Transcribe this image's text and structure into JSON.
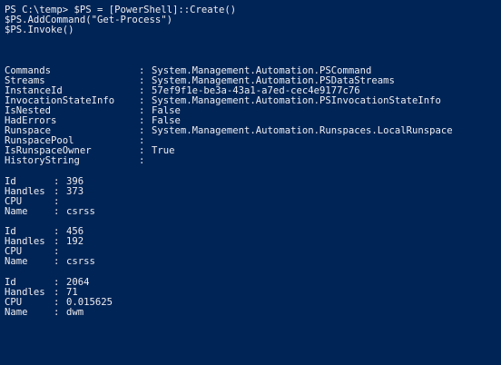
{
  "window": {
    "background": "#012456",
    "foreground": "#eeedf0"
  },
  "prompt_lines": [
    "PS C:\\temp> $PS = [PowerShell]::Create()",
    "$PS.AddCommand(\"Get-Process\")",
    "$PS.Invoke()"
  ],
  "properties": [
    {
      "key": "Commands",
      "value": "System.Management.Automation.PSCommand"
    },
    {
      "key": "Streams",
      "value": "System.Management.Automation.PSDataStreams"
    },
    {
      "key": "InstanceId",
      "value": "57ef9f1e-be3a-43a1-a7ed-cec4e9177c76"
    },
    {
      "key": "InvocationStateInfo",
      "value": "System.Management.Automation.PSInvocationStateInfo"
    },
    {
      "key": "IsNested",
      "value": "False"
    },
    {
      "key": "HadErrors",
      "value": "False"
    },
    {
      "key": "Runspace",
      "value": "System.Management.Automation.Runspaces.LocalRunspace"
    },
    {
      "key": "RunspacePool",
      "value": ""
    },
    {
      "key": "IsRunspaceOwner",
      "value": "True"
    },
    {
      "key": "HistoryString",
      "value": ""
    }
  ],
  "separator": ":",
  "processes": [
    {
      "fields": [
        {
          "key": "Id",
          "value": "396"
        },
        {
          "key": "Handles",
          "value": "373"
        },
        {
          "key": "CPU",
          "value": ""
        },
        {
          "key": "Name",
          "value": "csrss"
        }
      ]
    },
    {
      "fields": [
        {
          "key": "Id",
          "value": "456"
        },
        {
          "key": "Handles",
          "value": "192"
        },
        {
          "key": "CPU",
          "value": ""
        },
        {
          "key": "Name",
          "value": "csrss"
        }
      ]
    },
    {
      "fields": [
        {
          "key": "Id",
          "value": "2064"
        },
        {
          "key": "Handles",
          "value": "71"
        },
        {
          "key": "CPU",
          "value": "0.015625"
        },
        {
          "key": "Name",
          "value": "dwm"
        }
      ]
    }
  ]
}
